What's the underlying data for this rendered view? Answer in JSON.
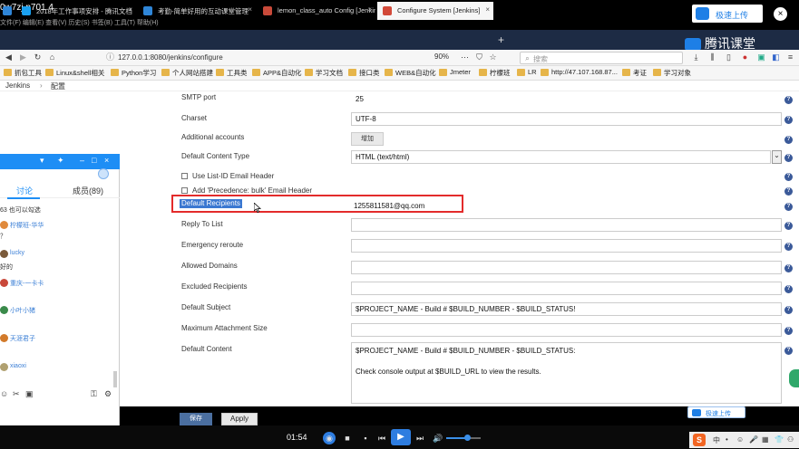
{
  "player": {
    "title": "0w7zj.p701.4",
    "menus": "文件(F)   编辑(E)   查看(V)   历史(S)   书签(B)   工具(T)   帮助(H)",
    "upload_label": "极速上传",
    "close_label": "×"
  },
  "browser": {
    "tabs": [
      {
        "label": "2018年工作事项安排 - 腾讯文档",
        "icon_color": "#1aa0f0"
      },
      {
        "label": "考勤-简单好用的互动课堂管理",
        "icon_color": "#2f86d8"
      },
      {
        "label": "lemon_class_auto Config [Jenkins]",
        "icon_color": "#c94a3a"
      },
      {
        "label": "Configure System [Jenkins]",
        "icon_color": "#d24939"
      }
    ],
    "tab_close": "×",
    "new_tab": "+",
    "brand": "腾讯课堂",
    "url": "127.0.0.1:8080/jenkins/configure",
    "zoom": "90%",
    "search_placeholder": "搜索",
    "nav_icons": [
      "back-icon",
      "forward-icon",
      "reload-icon",
      "home-icon"
    ],
    "bookmarks": [
      "抓包工具",
      "Linux&shell相关",
      "Python学习",
      "个人网站搭建",
      "工具类",
      "APP&自动化",
      "学习文档",
      "接口类",
      "WEB&自动化",
      "Jmeter",
      "柠檬班",
      "LR",
      "http://47.107.168.87...",
      "考证",
      "学习对象"
    ]
  },
  "breadcrumb": {
    "root": "Jenkins",
    "sep": "›",
    "current": "配置"
  },
  "form": {
    "smtp_port_label": "SMTP port",
    "smtp_port_value": "25",
    "charset_label": "Charset",
    "charset_value": "UTF-8",
    "additional_accounts_label": "Additional accounts",
    "add_button": "增加",
    "content_type_label": "Default Content Type",
    "content_type_value": "HTML (text/html)",
    "list_id_label": "Use List-ID Email Header",
    "precedence_label": "Add 'Precedence: bulk' Email Header",
    "recipients_label": "Default Recipients",
    "recipients_value": "1255811581@qq.com",
    "reply_to_label": "Reply To List",
    "emergency_label": "Emergency reroute",
    "allowed_domains_label": "Allowed Domains",
    "excluded_label": "Excluded Recipients",
    "subject_label": "Default Subject",
    "subject_value": "$PROJECT_NAME - Build # $BUILD_NUMBER - $BUILD_STATUS!",
    "max_attach_label": "Maximum Attachment Size",
    "content_label": "Default Content",
    "content_line1": "$PROJECT_NAME - Build # $BUILD_NUMBER - $BUILD_STATUS:",
    "content_line2": "Check console output at $BUILD_URL to view the results.",
    "save_button": "保存",
    "apply_button": "Apply",
    "help_glyph": "?",
    "dropdown_glyph": "⌄"
  },
  "qq": {
    "tab_discuss": "讨论",
    "tab_members": "成员(89)",
    "lines": [
      {
        "kind": "text",
        "text": "63 也可以勾选"
      },
      {
        "kind": "user",
        "text": "柠檬班-华华",
        "av": "#e08a3c"
      },
      {
        "kind": "text",
        "text": "？"
      },
      {
        "kind": "user",
        "text": "lucky",
        "av": "#7a5a3a"
      },
      {
        "kind": "text",
        "text": "好的"
      },
      {
        "kind": "user",
        "text": "重庆-一卡卡",
        "av": "#c9483a"
      },
      {
        "kind": "user",
        "text": "小叶小猪",
        "av": "#3a8a4a"
      },
      {
        "kind": "user",
        "text": "天涯君子",
        "av": "#d27a2a"
      },
      {
        "kind": "user",
        "text": "xiaoxi",
        "av": "#b0a070"
      }
    ],
    "bottom_icons": [
      "☺",
      "✂",
      "▣",
      "⚿",
      "⚙"
    ]
  },
  "playback": {
    "time": "01:54",
    "volume_fraction": 0.6,
    "upload_small": "极速上传"
  },
  "ime": {
    "logo": "S",
    "lang": "中",
    "items": [
      "•",
      "☺",
      "🎤",
      "▦",
      "👕",
      "⚇"
    ]
  }
}
